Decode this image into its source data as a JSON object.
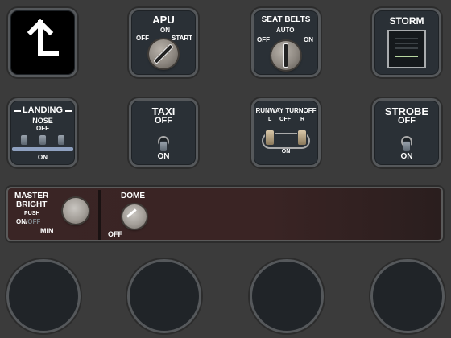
{
  "panel": {
    "apu": {
      "title": "APU",
      "off": "OFF",
      "on": "ON",
      "start": "START"
    },
    "seat_belts": {
      "title": "SEAT BELTS",
      "auto": "AUTO",
      "off": "OFF",
      "on": "ON"
    },
    "storm": {
      "title": "STORM"
    },
    "landing": {
      "title": "LANDING",
      "nose": "NOSE",
      "off": "OFF",
      "on": "ON"
    },
    "taxi": {
      "title": "TAXI",
      "off": "OFF",
      "on": "ON"
    },
    "runway_turnoff": {
      "title": "RUNWAY TURNOFF",
      "l": "L",
      "off": "OFF",
      "r": "R",
      "on": "ON"
    },
    "strobe": {
      "title": "STROBE",
      "off": "OFF",
      "on": "ON"
    },
    "lighting": {
      "master": "MASTER",
      "bright": "BRIGHT",
      "push": "PUSH",
      "on": "ON",
      "slash": "/",
      "off": "OFF",
      "min": "MIN",
      "dome": "DOME",
      "dome_off": "OFF"
    }
  },
  "colors": {
    "background": "#3b3b3b",
    "button_face": "#2a3036",
    "label": "#ffffff",
    "dim_label": "#7a8086",
    "indicator_green": "#b7d7a0",
    "lighting_strip": "#3a2424"
  },
  "icons": [
    "return-arrow-icon"
  ]
}
